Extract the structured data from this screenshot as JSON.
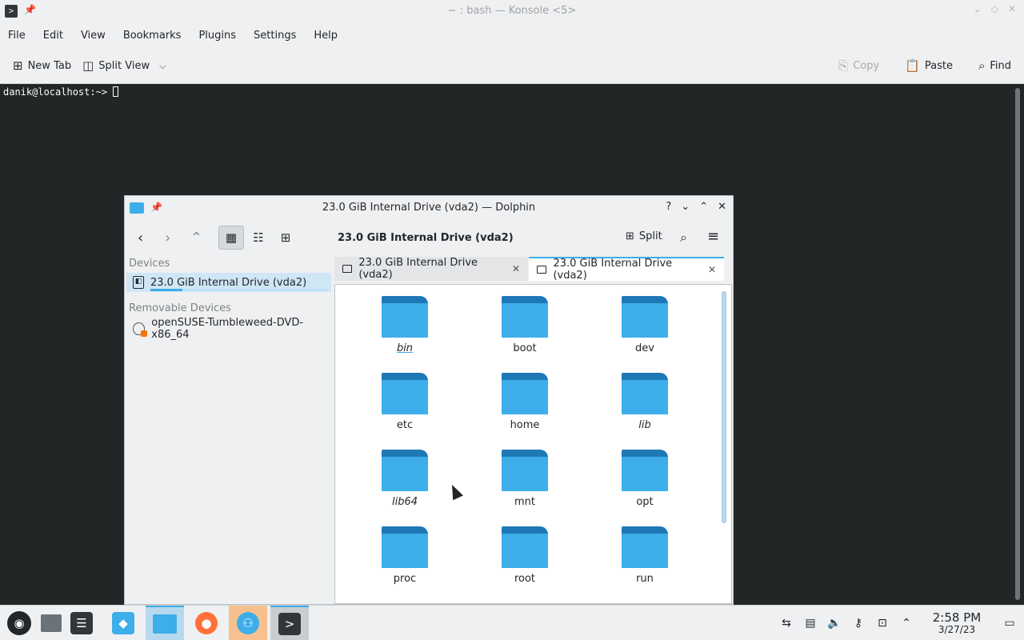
{
  "konsole": {
    "title": "~ : bash — Konsole <5>",
    "menu": [
      "File",
      "Edit",
      "View",
      "Bookmarks",
      "Plugins",
      "Settings",
      "Help"
    ],
    "toolbar": {
      "new_tab": "New Tab",
      "split_view": "Split View",
      "copy": "Copy",
      "paste": "Paste",
      "find": "Find"
    },
    "prompt": "danik@localhost:~>"
  },
  "dolphin": {
    "title": "23.0 GiB Internal Drive (vda2) — Dolphin",
    "location": "23.0 GiB Internal Drive (vda2)",
    "split_label": "Split",
    "sidebar": {
      "devices_heading": "Devices",
      "device_item": "23.0 GiB Internal Drive (vda2)",
      "device_usage_fraction": 0.18,
      "removable_heading": "Removable Devices",
      "removable_item": "openSUSE-Tumbleweed-DVD-x86_64"
    },
    "tabs": [
      {
        "label": "23.0 GiB Internal Drive (vda2)"
      },
      {
        "label": "23.0 GiB Internal Drive (vda2)"
      }
    ],
    "folders": [
      {
        "name": "bin",
        "italic": true,
        "current": true
      },
      {
        "name": "boot",
        "italic": false,
        "current": false
      },
      {
        "name": "dev",
        "italic": false,
        "current": false
      },
      {
        "name": "etc",
        "italic": false,
        "current": false
      },
      {
        "name": "home",
        "italic": false,
        "current": false
      },
      {
        "name": "lib",
        "italic": true,
        "current": false
      },
      {
        "name": "lib64",
        "italic": true,
        "current": false
      },
      {
        "name": "mnt",
        "italic": false,
        "current": false
      },
      {
        "name": "opt",
        "italic": false,
        "current": false
      },
      {
        "name": "proc",
        "italic": false,
        "current": false
      },
      {
        "name": "root",
        "italic": false,
        "current": false
      },
      {
        "name": "run",
        "italic": false,
        "current": false
      }
    ]
  },
  "taskbar": {
    "time": "2:58 PM",
    "date": "3/27/23"
  },
  "colors": {
    "accent": "#3daee9",
    "folder_body": "#3daee9",
    "folder_tab": "#1e78b6",
    "terminal_bg": "#232627"
  }
}
